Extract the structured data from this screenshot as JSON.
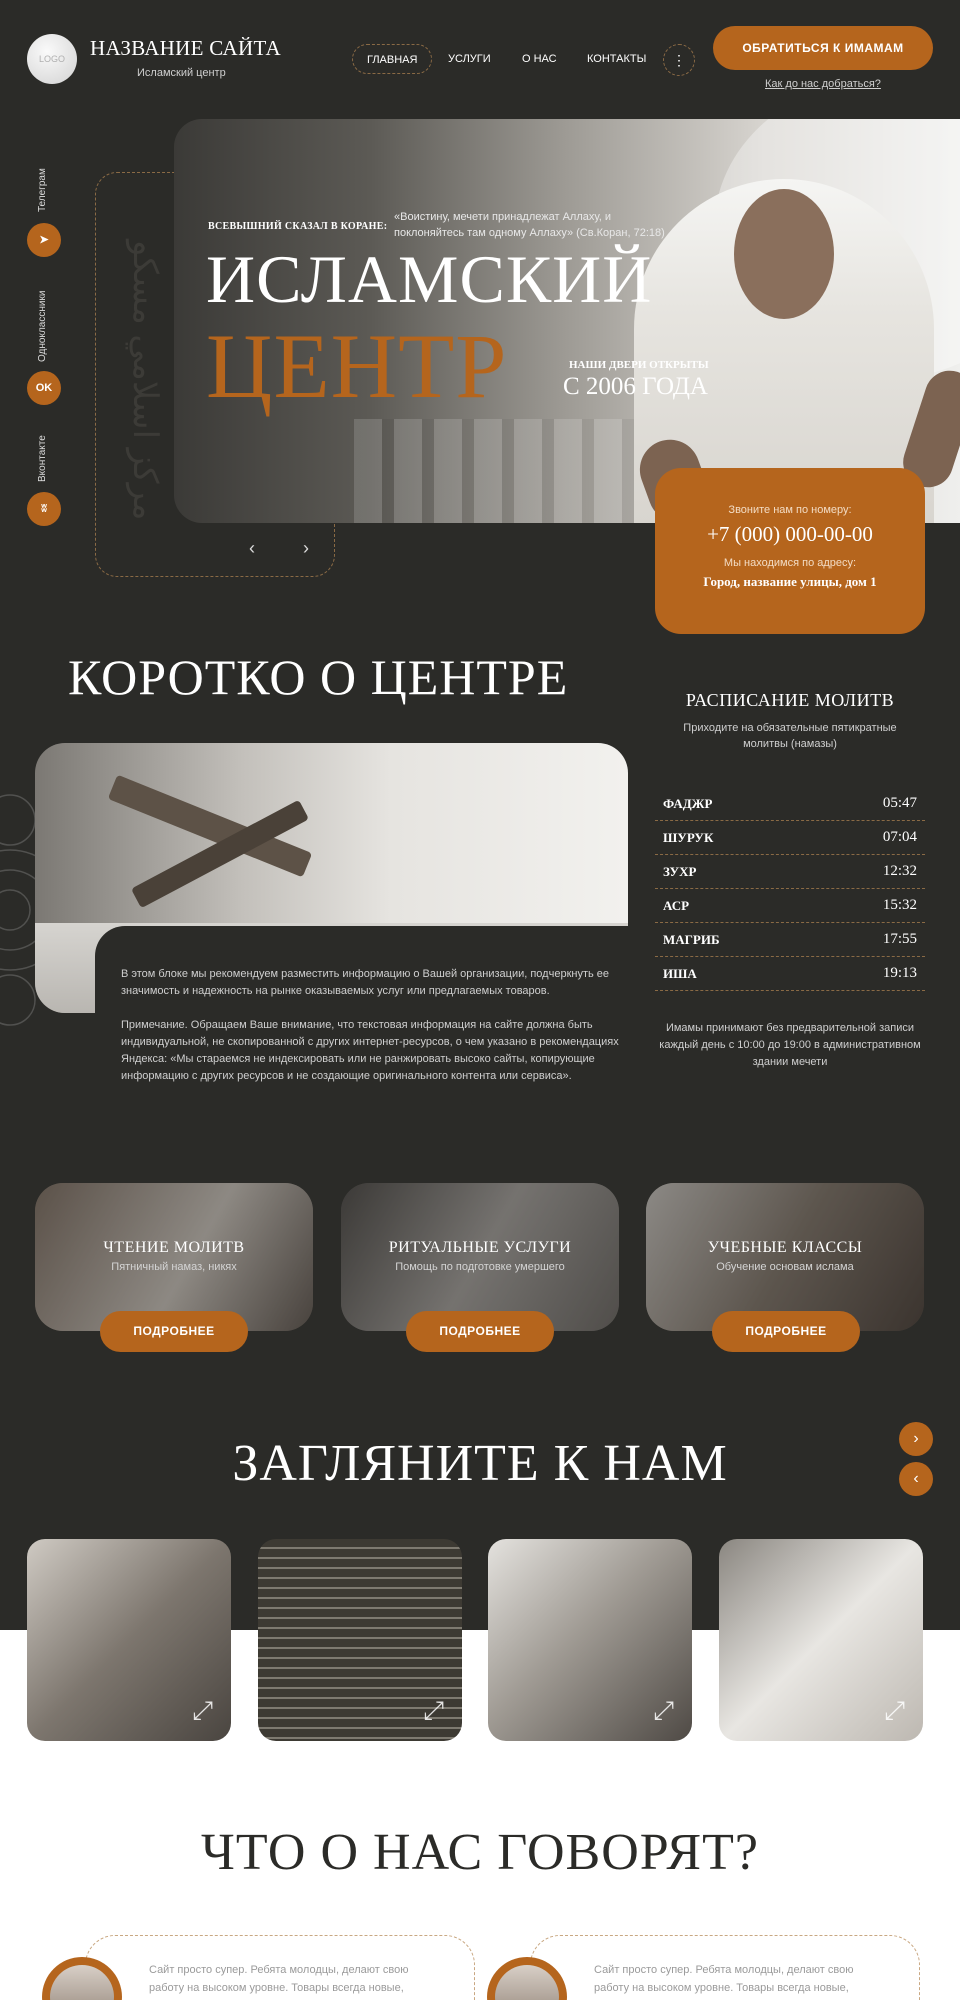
{
  "header": {
    "logo": "LOGO",
    "site_title": "НАЗВАНИЕ САЙТА",
    "site_subtitle": "Исламский центр",
    "nav": [
      "ГЛАВНАЯ",
      "УСЛУГИ",
      "О НАС",
      "КОНТАКТЫ"
    ],
    "more_icon": "⋮",
    "cta": "ОБРАТИТЬСЯ К ИМАМАМ",
    "directions_link": "Как до нас добраться?"
  },
  "social": [
    {
      "label": "Телеграм",
      "icon": "telegram-icon",
      "glyph": "➤"
    },
    {
      "label": "Одноклассники",
      "icon": "odnoklassniki-icon",
      "glyph": "OK"
    },
    {
      "label": "Вконтакте",
      "icon": "vk-icon",
      "glyph": "ʬ"
    }
  ],
  "hero": {
    "arabic": "مركز اسلامي مسكو",
    "kicker": "ВСЕВЫШНИЙ СКАЗАЛ В КОРАНЕ:",
    "quote": "«Воистину, мечети принадлежат Аллаху, и поклоняйтесь там одному Аллаху» (Св.Коран, 72:18)",
    "title_line1": "ИСЛАМСКИЙ",
    "title_line2": "ЦЕНТР",
    "doors_label": "НАШИ ДВЕРИ ОТКРЫТЫ",
    "since": "С 2006 ГОДА",
    "prev_arrow": "‹",
    "next_arrow": "›"
  },
  "contact_card": {
    "call_label": "Звоните нам по номеру:",
    "phone": "+7 (000) 000-00-00",
    "address_label": "Мы находимся по адресу:",
    "address": "Город, название улицы, дом 1"
  },
  "about": {
    "title": "КОРОТКО О ЦЕНТРЕ",
    "paragraph1": "В этом блоке мы рекомендуем разместить информацию о Вашей организации, подчеркнуть ее значимость и надежность на рынке оказываемых услуг или предлагаемых товаров.",
    "paragraph2": "Примечание. Обращаем Ваше внимание, что текстовая информация на сайте должна быть индивидуальной, не скопированной с других интернет-ресурсов, о чем указано в рекомендациях Яндекса: «Мы стараемся не индексировать или не ранжировать высоко сайты, копирующие информацию с других ресурсов и не создающие оригинального контента или сервиса»."
  },
  "prayer": {
    "title": "РАСПИСАНИЕ МОЛИТВ",
    "subtitle": "Приходите на обязательные пятикратные молитвы (намазы)",
    "times": [
      {
        "name": "ФАДЖР",
        "time": "05:47"
      },
      {
        "name": "ШУРУК",
        "time": "07:04"
      },
      {
        "name": "ЗУХР",
        "time": "12:32"
      },
      {
        "name": "АСР",
        "time": "15:32"
      },
      {
        "name": "МАГРИБ",
        "time": "17:55"
      },
      {
        "name": "ИША",
        "time": "19:13"
      }
    ],
    "note": "Имамы принимают без предварительной записи каждый день с 10:00 до 19:00 в административном здании мечети"
  },
  "services": [
    {
      "title": "ЧТЕНИЕ МОЛИТВ",
      "subtitle": "Пятничный намаз, никях",
      "button": "ПОДРОБНЕЕ"
    },
    {
      "title": "РИТУАЛЬНЫЕ УСЛУГИ",
      "subtitle": "Помощь  по подготовке умершего",
      "button": "ПОДРОБНЕЕ"
    },
    {
      "title": "УЧЕБНЫЕ КЛАССЫ",
      "subtitle": "Обучение основам ислама",
      "button": "ПОДРОБНЕЕ"
    }
  ],
  "gallery": {
    "title": "ЗАГЛЯНИТЕ К НАМ",
    "next_icon": "›",
    "prev_icon": "‹",
    "expand_icon": "⤢"
  },
  "reviews": {
    "title": "ЧТО О НАС ГОВОРЯТ?",
    "items": [
      {
        "text": "Сайт просто супер. Ребята молодцы, делают свою работу на высоком уровне. Товары всегда новые,"
      },
      {
        "text": "Сайт просто супер. Ребята молодцы, делают свою работу на высоком уровне. Товары всегда новые,"
      }
    ]
  },
  "colors": {
    "background": "#2b2b28",
    "accent": "#b5651d",
    "white_section": "#ffffff"
  }
}
